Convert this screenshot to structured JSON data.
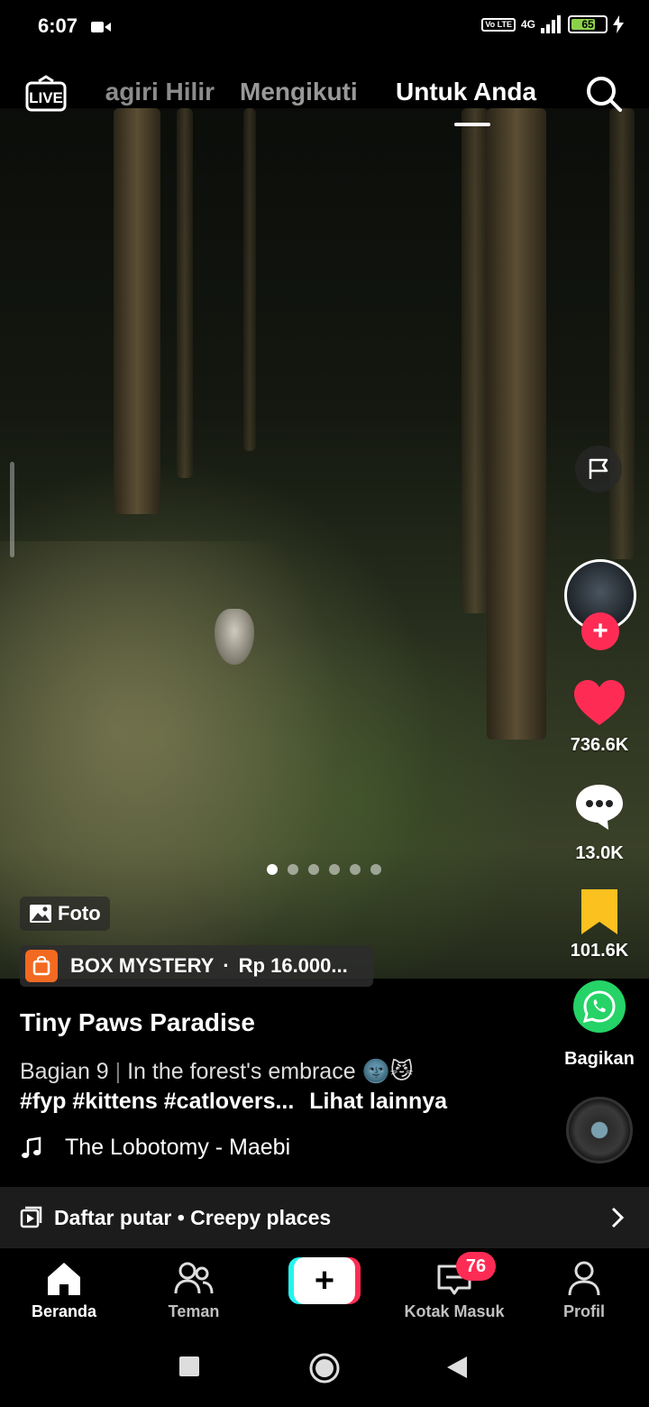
{
  "status_bar": {
    "time": "6:07",
    "network": "4G",
    "battery": "65",
    "volte": "Vo LTE"
  },
  "top_nav": {
    "live_label": "LIVE",
    "tabs": [
      {
        "label": "agiri Hilir"
      },
      {
        "label": "Mengikuti"
      },
      {
        "label": "Untuk Anda"
      }
    ]
  },
  "post": {
    "media_type_label": "Foto",
    "photo_count": 6,
    "active_photo_index": 0,
    "shop": {
      "name": "BOX MYSTERY",
      "separator": "·",
      "price": "Rp 16.000..."
    },
    "author": "Tiny Paws Paradise",
    "caption_title": "Bagian 9",
    "caption_sep": "|",
    "caption_text": "In the forest's embrace 🌚😼",
    "hashtags": "#fyp #kittens #catlovers...",
    "see_more": "Lihat lainnya",
    "music": "The Lobotomy - Maebi"
  },
  "actions": {
    "likes": "736.6K",
    "comments": "13.0K",
    "favorites": "101.6K",
    "share_label": "Bagikan"
  },
  "playlist": {
    "label": "Daftar putar • Creepy places"
  },
  "bottom_nav": {
    "home": "Beranda",
    "friends": "Teman",
    "create": "+",
    "inbox": "Kotak Masuk",
    "inbox_badge": "76",
    "profile": "Profil"
  },
  "colors": {
    "accent": "#fe2c55",
    "favorite": "#fbc11f",
    "share": "#25d366",
    "battery": "#8bd24a"
  }
}
